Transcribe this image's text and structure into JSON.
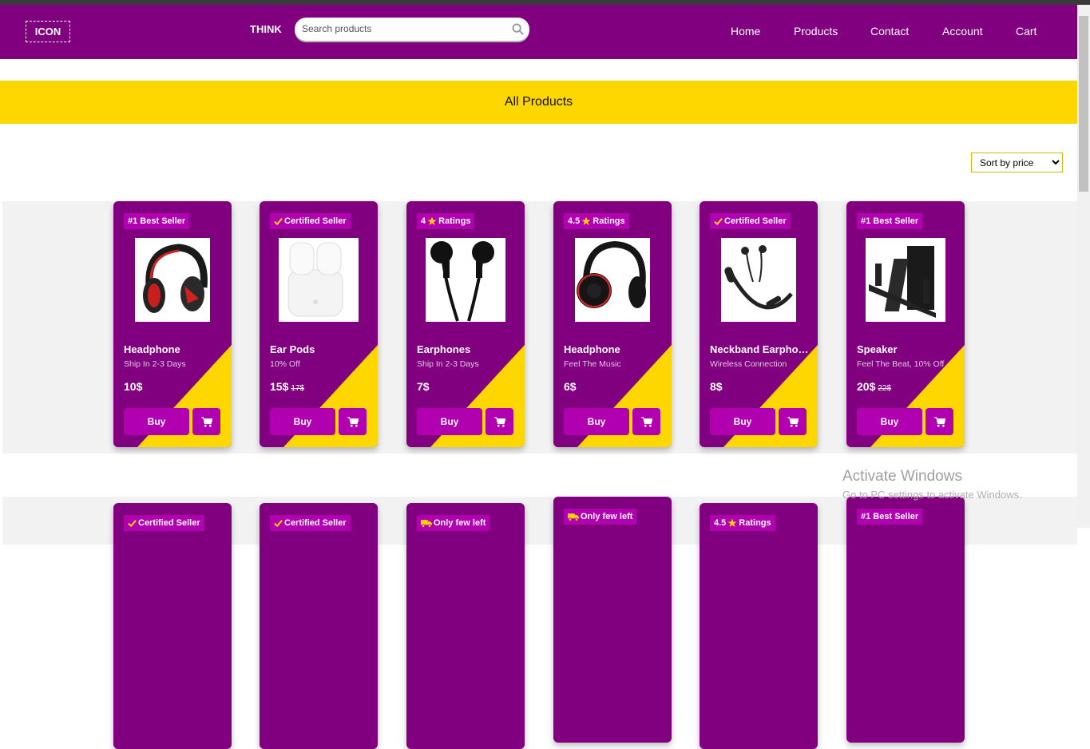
{
  "header": {
    "logo_text": "ICON",
    "brand": "THINK",
    "search_placeholder": "Search products",
    "nav": [
      "Home",
      "Products",
      "Contact",
      "Account",
      "Cart"
    ]
  },
  "banner_title": "All Products",
  "sort_label": "Sort by price",
  "colors": {
    "purple": "#800080",
    "gold": "#ffd700",
    "badge": "#b000b0"
  },
  "products": [
    {
      "badge": "#1 Best Seller",
      "badge_icon": "",
      "name": "Headphone",
      "desc": "Ship In 2-3 Days",
      "price": "10$",
      "old_price": "",
      "buy": "Buy",
      "image": "headphone-red"
    },
    {
      "badge": "Certified Seller",
      "badge_icon": "check",
      "name": "Ear Pods",
      "desc": "10% Off",
      "price": "15$",
      "old_price": "17$",
      "buy": "Buy",
      "image": "earpods"
    },
    {
      "badge": "Ratings",
      "badge_icon": "star",
      "badge_prefix": "4",
      "name": "Earphones",
      "desc": "Ship In 2-3 Days",
      "price": "7$",
      "old_price": "",
      "buy": "Buy",
      "image": "earphones"
    },
    {
      "badge": "Ratings",
      "badge_icon": "star",
      "badge_prefix": "4.5",
      "name": "Headphone",
      "desc": "Feel The Music",
      "price": "6$",
      "old_price": "",
      "buy": "Buy",
      "image": "headphone-black"
    },
    {
      "badge": "Certified Seller",
      "badge_icon": "check",
      "name": "Neckband Earphones",
      "desc": "Wireless Connection",
      "price": "8$",
      "old_price": "",
      "buy": "Buy",
      "image": "neckband"
    },
    {
      "badge": "#1 Best Seller",
      "badge_icon": "",
      "name": "Speaker",
      "desc": "Feel The Beat, 10% Off",
      "price": "20$",
      "old_price": "22$",
      "buy": "Buy",
      "image": "speaker"
    }
  ],
  "second_row_badges": [
    {
      "badge": "Certified Seller",
      "badge_icon": "check"
    },
    {
      "badge": "Certified Seller",
      "badge_icon": "check"
    },
    {
      "badge": "Only few left",
      "badge_icon": "truck"
    },
    {
      "badge": "Only few left",
      "badge_icon": "truck"
    },
    {
      "badge": "Ratings",
      "badge_icon": "star",
      "badge_prefix": "4.5"
    },
    {
      "badge": "#1 Best Seller",
      "badge_icon": ""
    }
  ],
  "watermark": {
    "line1": "Activate Windows",
    "line2": "Go to PC settings to activate Windows."
  }
}
